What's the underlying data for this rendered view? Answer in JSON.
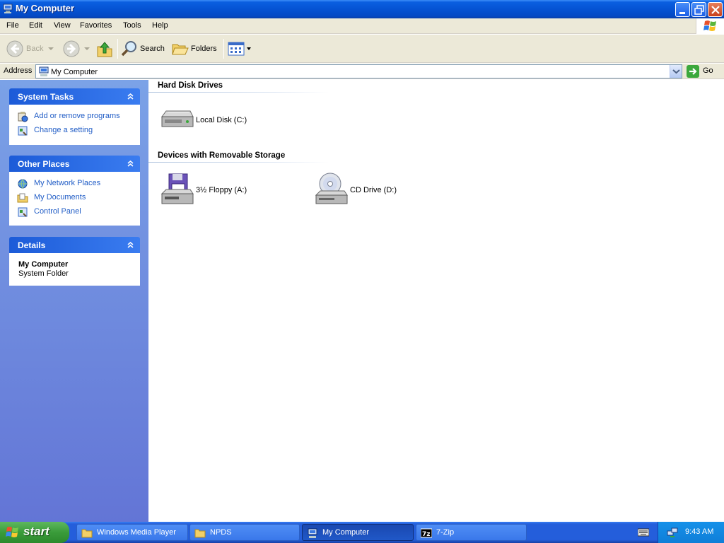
{
  "window": {
    "title": "My Computer"
  },
  "menu": {
    "items": [
      "File",
      "Edit",
      "View",
      "Favorites",
      "Tools",
      "Help"
    ]
  },
  "toolbar": {
    "back_label": "Back",
    "search_label": "Search",
    "folders_label": "Folders"
  },
  "address": {
    "label": "Address",
    "value": "My Computer",
    "go_label": "Go"
  },
  "sidebar": {
    "system_tasks": {
      "title": "System Tasks",
      "items": [
        {
          "label": "Add or remove programs",
          "icon": "add-remove-programs-icon"
        },
        {
          "label": "Change a setting",
          "icon": "control-panel-icon"
        }
      ]
    },
    "other_places": {
      "title": "Other Places",
      "items": [
        {
          "label": "My Network Places",
          "icon": "network-places-icon"
        },
        {
          "label": "My Documents",
          "icon": "my-documents-icon"
        },
        {
          "label": "Control Panel",
          "icon": "control-panel-icon"
        }
      ]
    },
    "details": {
      "title": "Details",
      "name": "My Computer",
      "type": "System Folder"
    }
  },
  "content": {
    "groups": [
      {
        "title": "Hard Disk Drives",
        "items": [
          {
            "label": "Local Disk (C:)",
            "icon": "hard-disk-icon"
          }
        ]
      },
      {
        "title": "Devices with Removable Storage",
        "items": [
          {
            "label": "3½ Floppy (A:)",
            "icon": "floppy-drive-icon"
          },
          {
            "label": "CD Drive (D:)",
            "icon": "cd-drive-icon"
          }
        ]
      }
    ]
  },
  "taskbar": {
    "start_label": "start",
    "tasks": [
      {
        "label": "Windows Media Player",
        "icon": "folder-icon",
        "active": false
      },
      {
        "label": "NPDS",
        "icon": "folder-icon",
        "active": false
      },
      {
        "label": "My Computer",
        "icon": "my-computer-icon",
        "active": true
      },
      {
        "label": "7-Zip",
        "icon": "7zip-icon",
        "active": false
      }
    ],
    "clock": "9:43 AM"
  },
  "colors": {
    "title_bar": "#0553d3",
    "sidebar_gradient_top": "#7ba2e7",
    "sidebar_gradient_bottom": "#6375d6",
    "task_link": "#215dc6",
    "taskbar": "#245edb",
    "start_button": "#3a9b3a"
  }
}
